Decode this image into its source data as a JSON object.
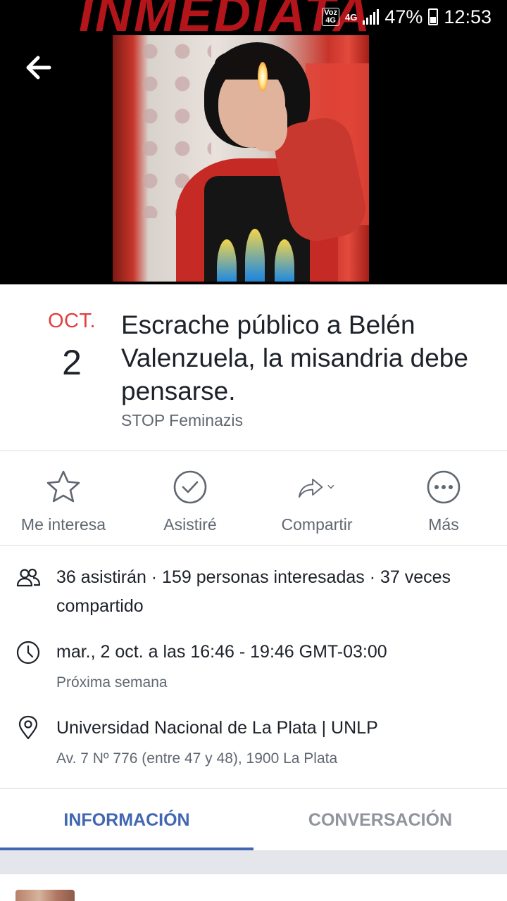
{
  "status_bar": {
    "volte": "Voz 4G",
    "network": "4G",
    "battery_percent": "47%",
    "time": "12:53",
    "icons": [
      "volte-icon",
      "signal-icon",
      "battery-icon"
    ]
  },
  "cover": {
    "brand_text": "INMEDIATA",
    "back_icon": "arrow-left-icon"
  },
  "event": {
    "month": "OCT.",
    "day": "2",
    "title": "Escrache público a Belén Valenzuela, la misandria debe pensarse.",
    "host": "STOP Feminazis"
  },
  "actions": [
    {
      "label": "Me interesa",
      "icon": "star-icon"
    },
    {
      "label": "Asistiré",
      "icon": "check-circle-icon"
    },
    {
      "label": "Compartir",
      "icon": "share-icon"
    },
    {
      "label": "Más",
      "icon": "more-icon"
    }
  ],
  "details": {
    "stats": "36 asistirán · 159 personas interesadas · 37 veces compartido",
    "datetime": "mar., 2 oct. a las 16:46 - 19:46 GMT-03:00",
    "datetime_sub": "Próxima semana",
    "place": "Universidad Nacional de La Plata | UNLP",
    "address": "Av. 7 Nº 776 (entre 47 y 48), 1900 La Plata"
  },
  "tabs": [
    {
      "label": "INFORMACIÓN",
      "active": true
    },
    {
      "label": "CONVERSACIÓN",
      "active": false
    }
  ],
  "colors": {
    "accent": "#4267b2",
    "date_red": "#e0403f",
    "text": "#1d2129",
    "secondary": "#606770"
  }
}
